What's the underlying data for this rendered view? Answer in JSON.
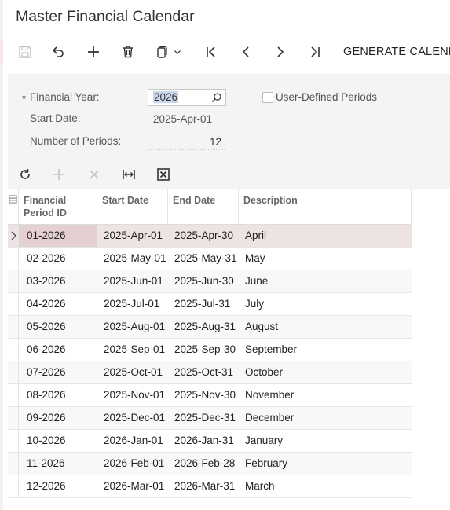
{
  "window": {
    "title": "Master Financial Calendar"
  },
  "toolbar": {
    "buttons": [
      {
        "name": "save-icon",
        "enabled": false
      },
      {
        "name": "undo-icon",
        "enabled": true
      },
      {
        "name": "plus-icon",
        "enabled": true
      },
      {
        "name": "trash-icon",
        "enabled": true
      },
      {
        "name": "clipboard-icon",
        "enabled": true
      },
      {
        "name": "chevron-down-icon",
        "enabled": true
      },
      {
        "name": "first-record-icon",
        "enabled": true
      },
      {
        "name": "previous-icon",
        "enabled": true
      },
      {
        "name": "next-icon",
        "enabled": true
      },
      {
        "name": "last-record-icon",
        "enabled": true
      }
    ],
    "generate_label": "GENERATE CALEND"
  },
  "form": {
    "required_mark": "*",
    "financial_year": {
      "label": "Financial Year:",
      "value": "2026"
    },
    "start_date": {
      "label": "Start Date:",
      "value": "2025-Apr-01"
    },
    "number_of_periods": {
      "label": "Number of Periods:",
      "value": "12"
    },
    "user_defined_periods": {
      "label": "User-Defined Periods",
      "checked": false
    }
  },
  "grid_toolbar": {
    "buttons": [
      {
        "name": "refresh-icon",
        "enabled": true
      },
      {
        "name": "add-row-icon",
        "enabled": false
      },
      {
        "name": "delete-row-icon",
        "enabled": false
      },
      {
        "name": "fit-columns-icon",
        "enabled": true
      },
      {
        "name": "excel-export-icon",
        "enabled": true
      }
    ]
  },
  "grid": {
    "headers": {
      "financial_period_id": "Financial\nPeriod ID",
      "start_date": "Start Date",
      "end_date": "End Date",
      "description": "Description"
    },
    "rows": [
      {
        "id": "01-2026",
        "start": "2025-Apr-01",
        "end": "2025-Apr-30",
        "desc": "April"
      },
      {
        "id": "02-2026",
        "start": "2025-May-01",
        "end": "2025-May-31",
        "desc": "May"
      },
      {
        "id": "03-2026",
        "start": "2025-Jun-01",
        "end": "2025-Jun-30",
        "desc": "June"
      },
      {
        "id": "04-2026",
        "start": "2025-Jul-01",
        "end": "2025-Jul-31",
        "desc": "July"
      },
      {
        "id": "05-2026",
        "start": "2025-Aug-01",
        "end": "2025-Aug-31",
        "desc": "August"
      },
      {
        "id": "06-2026",
        "start": "2025-Sep-01",
        "end": "2025-Sep-30",
        "desc": "September"
      },
      {
        "id": "07-2026",
        "start": "2025-Oct-01",
        "end": "2025-Oct-31",
        "desc": "October"
      },
      {
        "id": "08-2026",
        "start": "2025-Nov-01",
        "end": "2025-Nov-30",
        "desc": "November"
      },
      {
        "id": "09-2026",
        "start": "2025-Dec-01",
        "end": "2025-Dec-31",
        "desc": "December"
      },
      {
        "id": "10-2026",
        "start": "2026-Jan-01",
        "end": "2026-Jan-31",
        "desc": "January"
      },
      {
        "id": "11-2026",
        "start": "2026-Feb-01",
        "end": "2026-Feb-28",
        "desc": "February"
      },
      {
        "id": "12-2026",
        "start": "2026-Mar-01",
        "end": "2026-Mar-31",
        "desc": "March"
      }
    ],
    "active_row_index": 0
  },
  "colors": {
    "active_row": "#eee3e3",
    "form_background": "#f4f4f4",
    "selection": "#c9d8ec"
  }
}
